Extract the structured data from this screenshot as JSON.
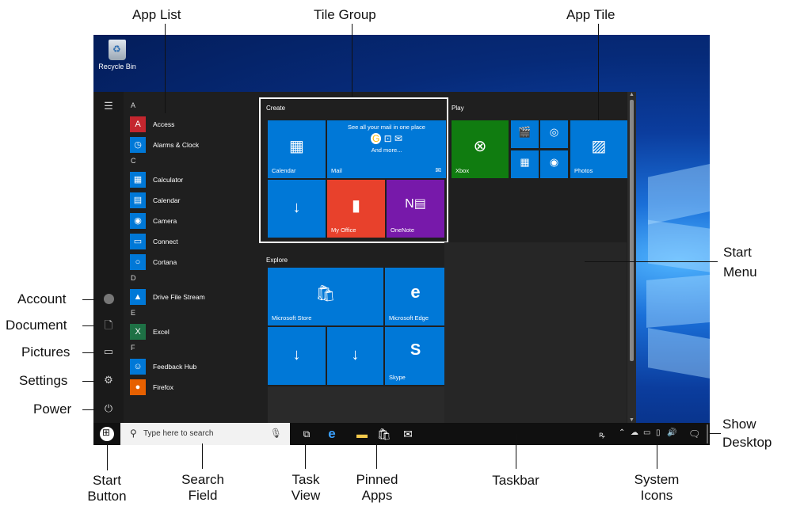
{
  "annotations": {
    "app_list": "App List",
    "tile_group": "Tile Group",
    "app_tile": "App Tile",
    "start_menu": [
      "Start",
      "Menu"
    ],
    "account": "Account",
    "document": "Document",
    "pictures": "Pictures",
    "settings": "Settings",
    "power": "Power",
    "show_desktop": [
      "Show",
      "Desktop"
    ],
    "start_button": [
      "Start",
      "Button"
    ],
    "search_field": [
      "Search",
      "Field"
    ],
    "task_view": [
      "Task",
      "View"
    ],
    "pinned_apps": [
      "Pinned",
      "Apps"
    ],
    "taskbar": "Taskbar",
    "system_icons": [
      "System",
      "Icons"
    ]
  },
  "desktop": {
    "recycle_bin_label": "Recycle Bin"
  },
  "start_menu": {
    "rail_icons": [
      "hamburger-icon",
      "account-icon",
      "document-icon",
      "pictures-icon",
      "settings-icon",
      "power-icon"
    ],
    "app_list": [
      {
        "letter": "A"
      },
      {
        "name": "Access",
        "icon": "access-icon",
        "glyph": "A",
        "color": "#c4262e"
      },
      {
        "name": "Alarms & Clock",
        "icon": "clock-icon",
        "glyph": "◷",
        "color": "#0078d7"
      },
      {
        "letter": "C"
      },
      {
        "name": "Calculator",
        "icon": "calculator-icon",
        "glyph": "▦",
        "color": "#0078d7"
      },
      {
        "name": "Calendar",
        "icon": "calendar-icon",
        "glyph": "▤",
        "color": "#0078d7"
      },
      {
        "name": "Camera",
        "icon": "camera-icon",
        "glyph": "◉",
        "color": "#0078d7"
      },
      {
        "name": "Connect",
        "icon": "connect-icon",
        "glyph": "▭",
        "color": "#0078d7"
      },
      {
        "name": "Cortana",
        "icon": "cortana-icon",
        "glyph": "○",
        "color": "#0078d7"
      },
      {
        "letter": "D"
      },
      {
        "name": "Drive File Stream",
        "icon": "drive-icon",
        "glyph": "▲",
        "color": "#0078d7"
      },
      {
        "letter": "E"
      },
      {
        "name": "Excel",
        "icon": "excel-icon",
        "glyph": "X",
        "color": "#1e7145"
      },
      {
        "letter": "F"
      },
      {
        "name": "Feedback Hub",
        "icon": "feedback-icon",
        "glyph": "☺",
        "color": "#0078d7"
      },
      {
        "name": "Firefox",
        "icon": "firefox-icon",
        "glyph": "●",
        "color": "#e66000"
      }
    ],
    "groups": {
      "create": "Create",
      "explore": "Explore",
      "play": "Play"
    },
    "tiles": {
      "calendar": "Calendar",
      "mail": "Mail",
      "mail_headline": "See all your mail in one place",
      "mail_more": "And more...",
      "my_office": "My Office",
      "onenote": "OneNote",
      "microsoft_store": "Microsoft Store",
      "microsoft_edge": "Microsoft Edge",
      "skype": "Skype",
      "xbox": "Xbox",
      "photos": "Photos"
    },
    "colors": {
      "tile_blue": "#0078d7",
      "office_red": "#e8412c",
      "onenote_purple": "#7719aa",
      "xbox_green": "#107c10"
    }
  },
  "taskbar": {
    "search_placeholder": "Type here to search",
    "pinned": [
      "task-view-icon",
      "edge-icon",
      "file-explorer-icon",
      "store-icon",
      "mail-icon"
    ],
    "tray": [
      "people-icon",
      "chevron-up-icon",
      "onedrive-icon",
      "battery-icon",
      "network-icon",
      "volume-icon",
      "action-center-icon"
    ]
  }
}
